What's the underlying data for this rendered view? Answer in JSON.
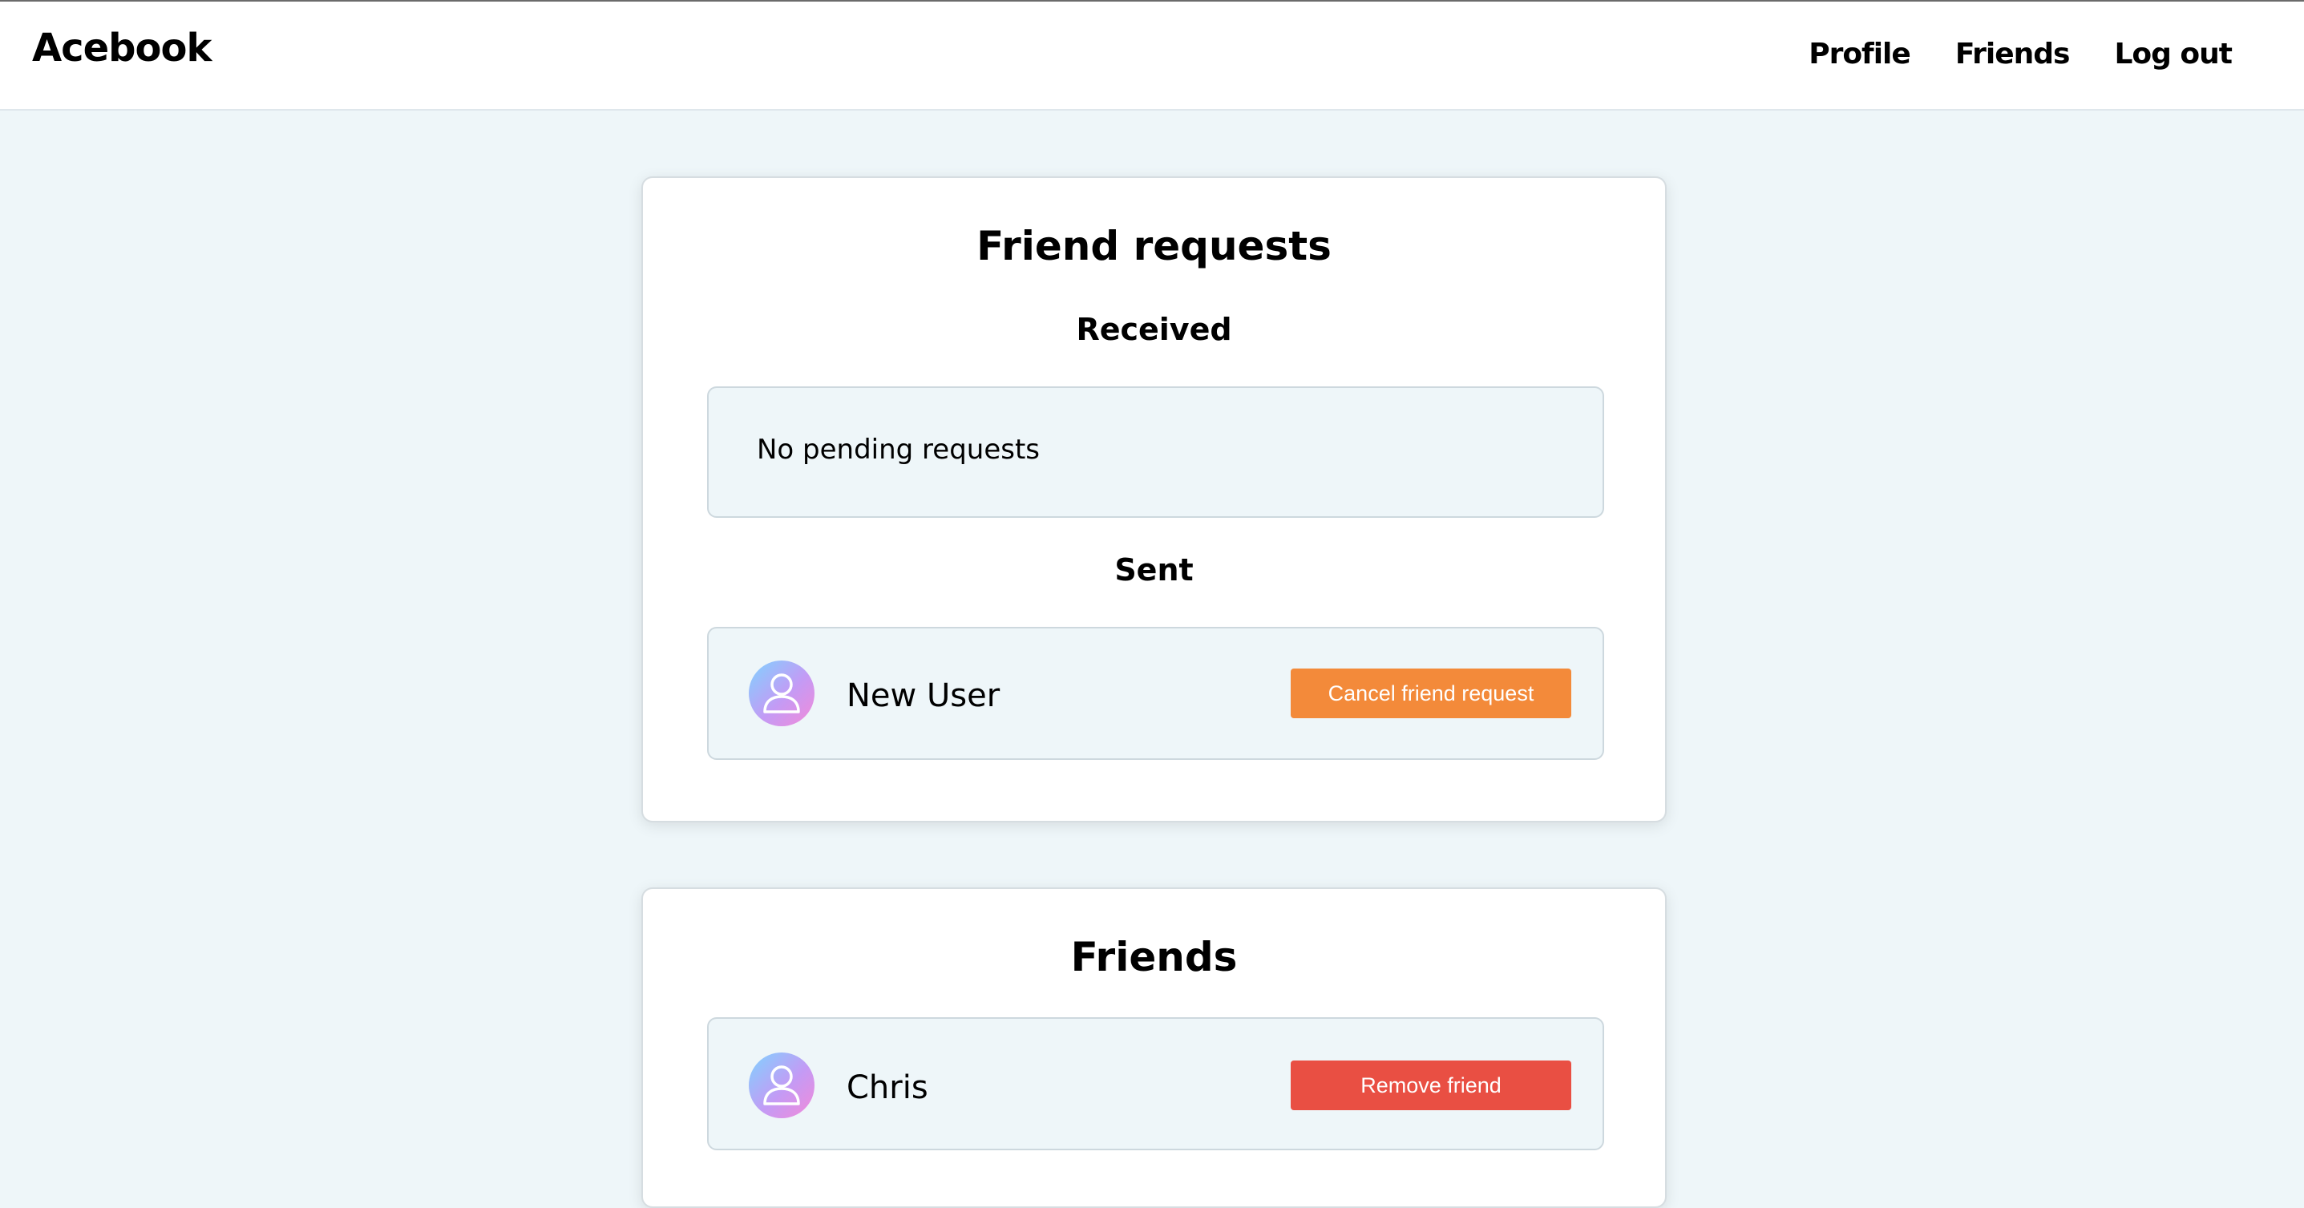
{
  "navbar": {
    "brand": "Acebook",
    "links": [
      {
        "label": "Profile"
      },
      {
        "label": "Friends"
      },
      {
        "label": "Log out"
      }
    ]
  },
  "friend_requests": {
    "title": "Friend requests",
    "received": {
      "heading": "Received",
      "empty_text": "No pending requests"
    },
    "sent": {
      "heading": "Sent",
      "items": [
        {
          "name": "New User",
          "action_label": "Cancel friend request",
          "avatar_icon": "user-avatar-icon"
        }
      ]
    }
  },
  "friends": {
    "title": "Friends",
    "items": [
      {
        "name": "Chris",
        "action_label": "Remove friend",
        "avatar_icon": "user-avatar-icon"
      }
    ]
  },
  "colors": {
    "page_background": "#eef6f9",
    "cancel_button": "#f38a3a",
    "remove_button": "#e94f43"
  }
}
